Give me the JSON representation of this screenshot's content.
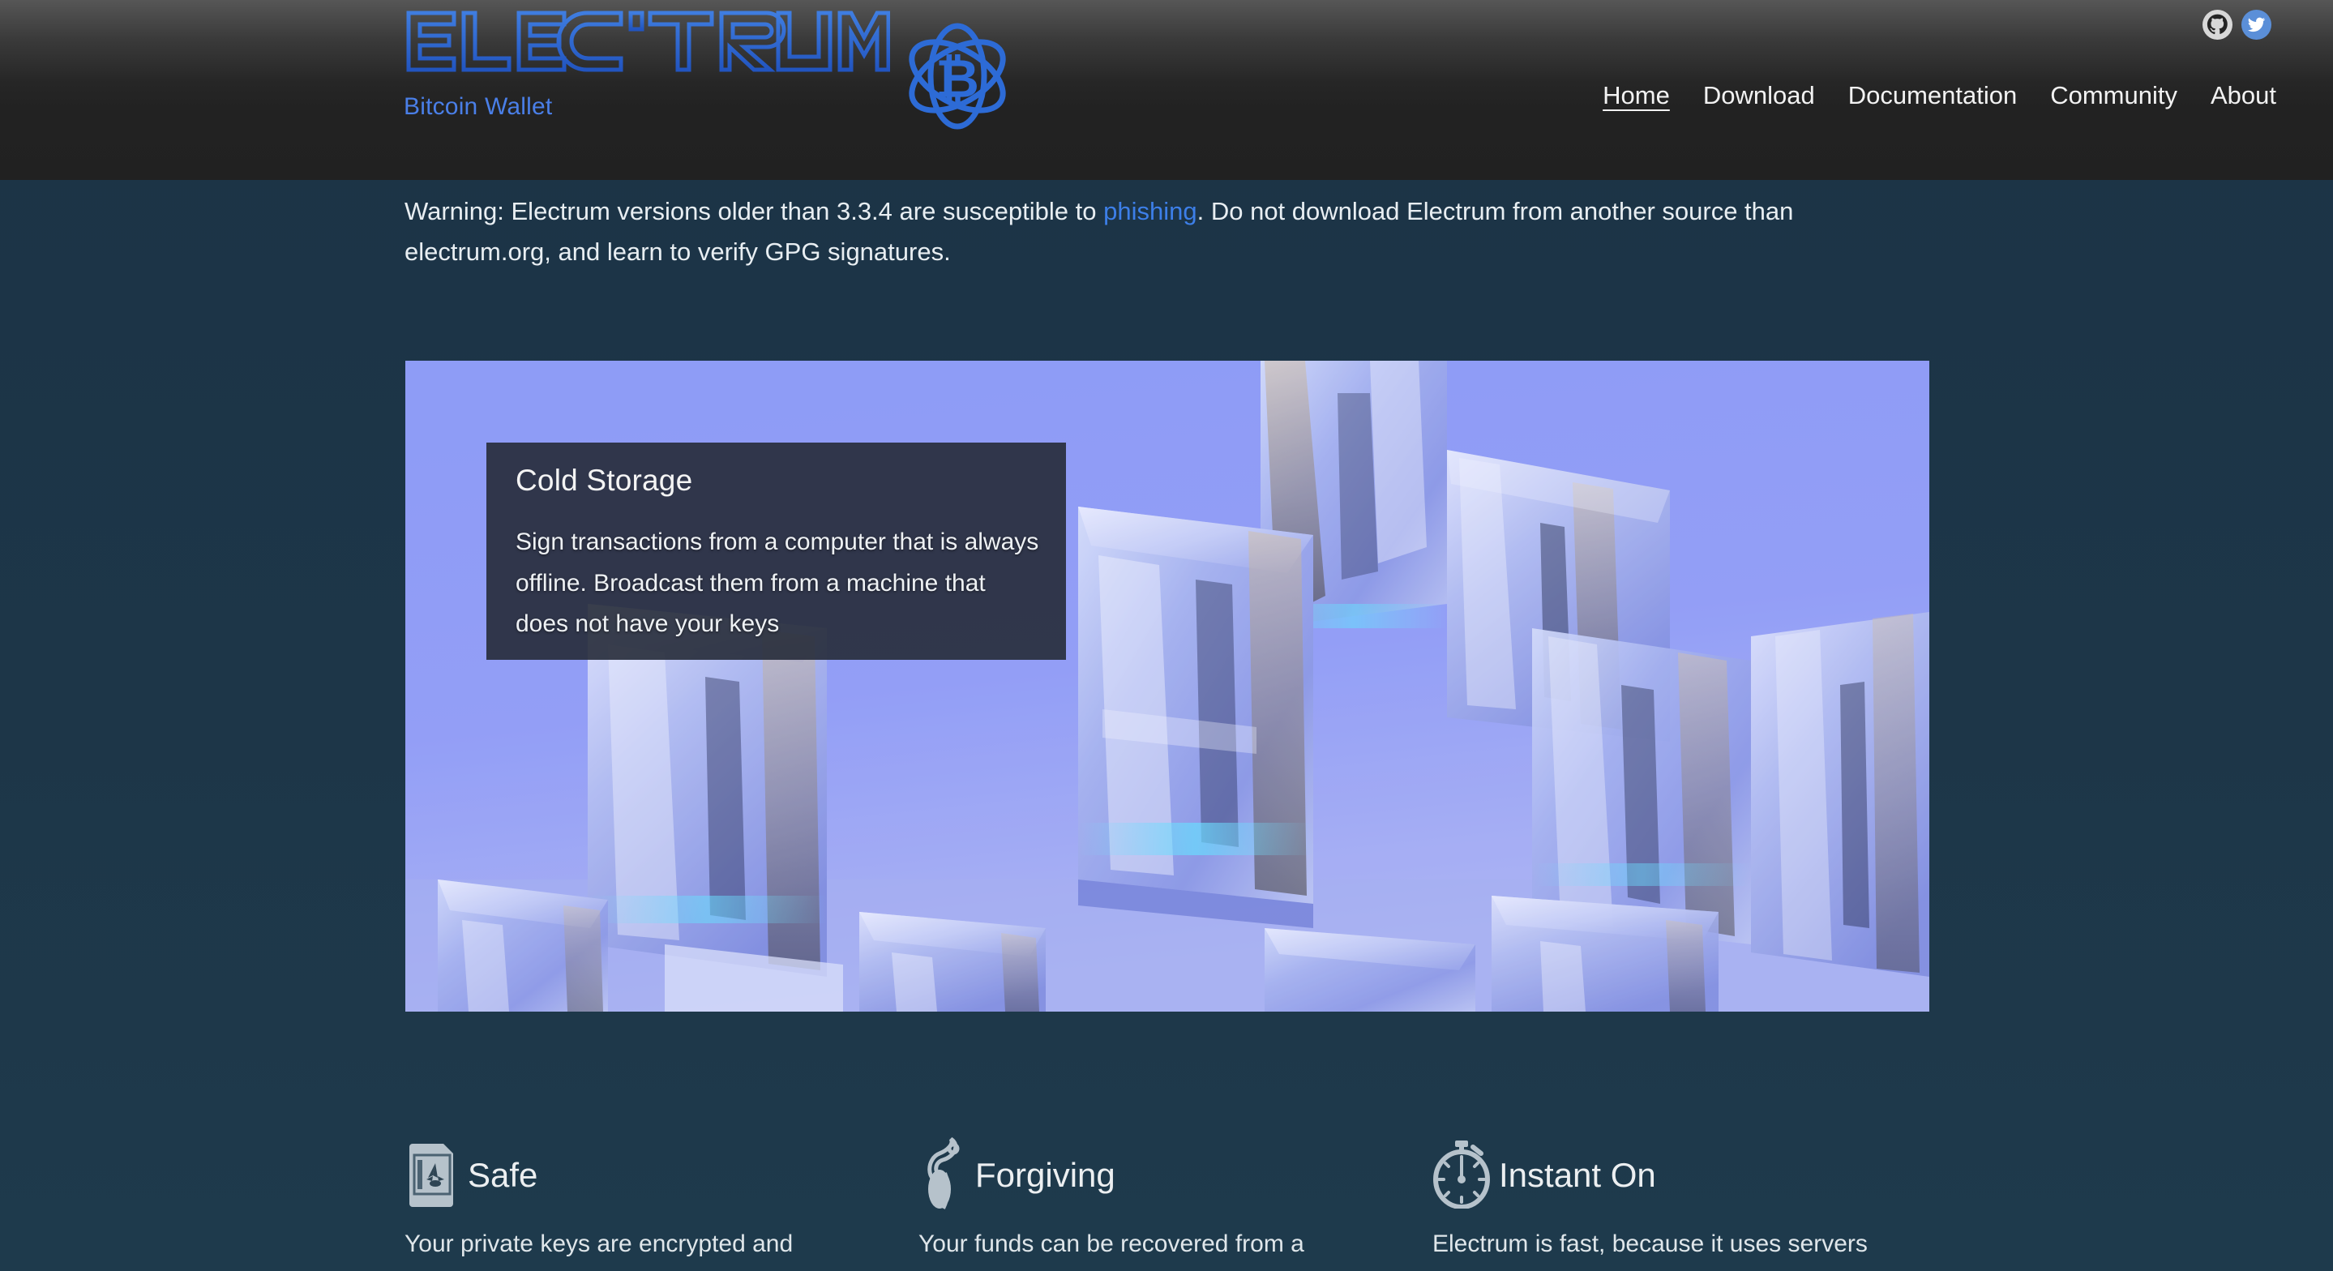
{
  "header": {
    "brand": {
      "wordmark_text": "ELECTRUM",
      "tagline": "Bitcoin Wallet",
      "logo_icon": "atom-bitcoin-icon",
      "logo_color": "#2d6bd6",
      "tagline_color": "#4a7fe8"
    },
    "social": [
      {
        "name": "github-icon",
        "label": "GitHub",
        "bg": "#d8d8d8"
      },
      {
        "name": "twitter-icon",
        "label": "Twitter",
        "bg": "#5b8fd8"
      }
    ],
    "nav": [
      {
        "label": "Home",
        "active": true
      },
      {
        "label": "Download",
        "active": false
      },
      {
        "label": "Documentation",
        "active": false
      },
      {
        "label": "Community",
        "active": false
      },
      {
        "label": "About",
        "active": false
      }
    ]
  },
  "warning": {
    "before_link": "Warning: Electrum versions older than 3.3.4 are susceptible to ",
    "link_text": "phishing",
    "after_link": ". Do not download Electrum from another source than electrum.org, and learn to verify GPG signatures.",
    "link_color": "#3d7fe8"
  },
  "hero": {
    "image_alt": "ice-cubes-photo",
    "card": {
      "title": "Cold Storage",
      "body": "Sign transactions from a computer that is always offline. Broadcast them from a machine that does not have your keys"
    }
  },
  "features": [
    {
      "icon": "safe-vault-icon",
      "title": "Safe",
      "description": "Your private keys are encrypted and"
    },
    {
      "icon": "seed-sprout-icon",
      "title": "Forgiving",
      "description": "Your funds can be recovered from a"
    },
    {
      "icon": "stopwatch-icon",
      "title": "Instant On",
      "description": "Electrum is fast, because it uses servers"
    }
  ],
  "colors": {
    "page_bg": "#1c3448",
    "header_bg_top": "#565656",
    "header_bg_bottom": "#212121",
    "hero_bg": "#8e9df6",
    "card_bg": "rgba(38,43,56,.90)",
    "text": "#e8eef2",
    "icon_gray": "#b6c2cb"
  }
}
